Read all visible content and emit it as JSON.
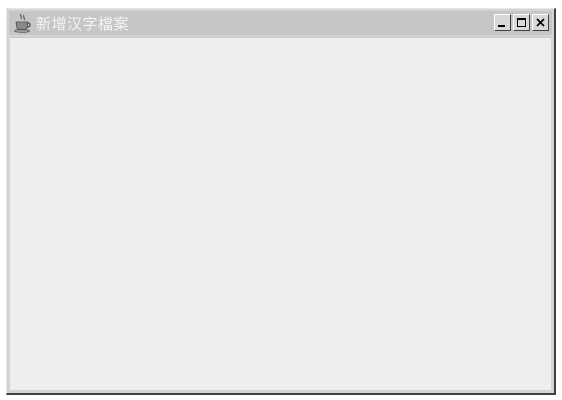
{
  "window": {
    "title": "新增汉字檔案",
    "icon": "java-coffee-cup-icon",
    "controls": [
      "minimize-icon",
      "maximize-icon",
      "close-icon"
    ]
  },
  "colors": {
    "titlebar": "#c6c6c6",
    "title_text": "#f4f4f4",
    "client_area": "#eeeeee"
  }
}
